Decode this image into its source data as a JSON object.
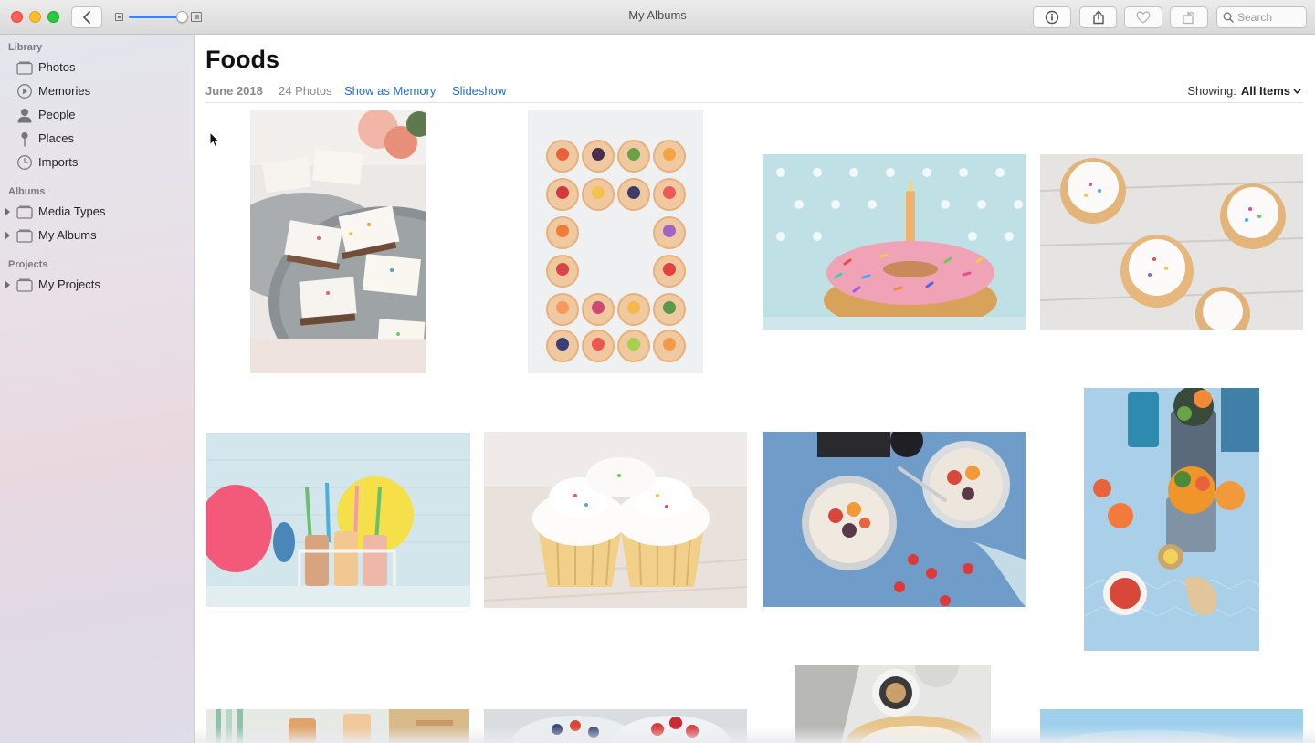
{
  "window": {
    "title": "My Albums"
  },
  "toolbar": {
    "search_placeholder": "Search",
    "zoom_level": 0.88
  },
  "sidebar": {
    "sections": [
      {
        "title": "Library",
        "items": [
          {
            "label": "Photos",
            "icon": "photos-icon"
          },
          {
            "label": "Memories",
            "icon": "memories-icon"
          },
          {
            "label": "People",
            "icon": "people-icon"
          },
          {
            "label": "Places",
            "icon": "pin-icon"
          },
          {
            "label": "Imports",
            "icon": "clock-icon"
          }
        ]
      },
      {
        "title": "Albums",
        "items": [
          {
            "label": "Media Types",
            "icon": "folder-icon"
          },
          {
            "label": "My Albums",
            "icon": "folder-icon"
          }
        ]
      },
      {
        "title": "Projects",
        "items": [
          {
            "label": "My Projects",
            "icon": "folder-icon"
          }
        ]
      }
    ]
  },
  "album": {
    "title": "Foods",
    "date": "June 2018",
    "count": "24 Photos",
    "show_memory": "Show as Memory",
    "slideshow": "Slideshow",
    "showing_label": "Showing:",
    "showing_value": "All Items"
  },
  "colors": {
    "accent": "#1f6fd1",
    "close": "#fe5f57",
    "minimize": "#febc2e",
    "maximize": "#28c840"
  },
  "photos": [
    {
      "name": "photo-frosted-bars"
    },
    {
      "name": "photo-fruit-tarts"
    },
    {
      "name": "photo-sprinkle-donut"
    },
    {
      "name": "photo-cupcakes-top"
    },
    {
      "name": "photo-balloons-milk"
    },
    {
      "name": "photo-two-cupcakes"
    },
    {
      "name": "photo-fruit-bowls"
    },
    {
      "name": "photo-smoothie-cups"
    },
    {
      "name": "photo-green-straws"
    },
    {
      "name": "photo-berry-bowls"
    },
    {
      "name": "photo-granola-pie"
    },
    {
      "name": "photo-blue-dessert"
    }
  ]
}
